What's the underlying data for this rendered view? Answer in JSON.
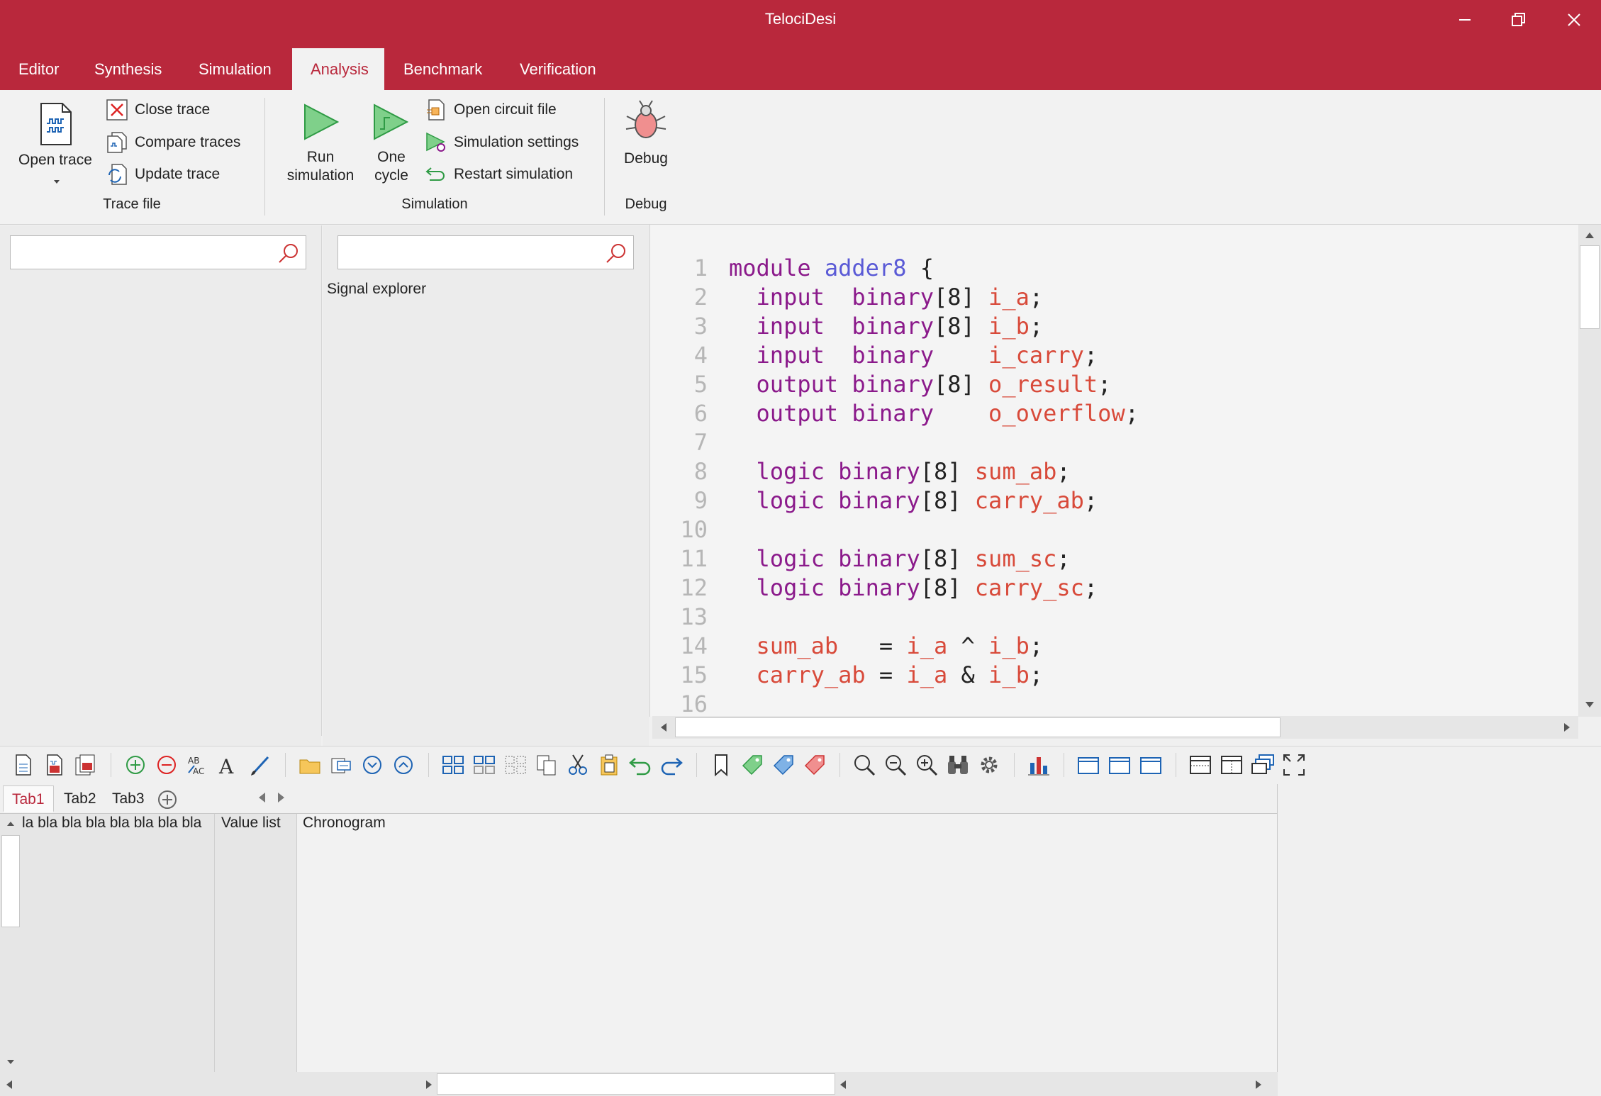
{
  "app": {
    "title": "TelociDesi"
  },
  "window_controls": {
    "minimize": "—",
    "restore": "❐",
    "close": "✕"
  },
  "tabs": [
    "Editor",
    "Synthesis",
    "Simulation",
    "Analysis",
    "Benchmark",
    "Verification"
  ],
  "active_tab": "Analysis",
  "ribbon": {
    "trace_file": {
      "open_trace": "Open trace",
      "close_trace": "Close trace",
      "compare_traces": "Compare traces",
      "update_trace": "Update trace",
      "group_label": "Trace file"
    },
    "simulation": {
      "run_simulation_line1": "Run",
      "run_simulation_line2": "simulation",
      "one_cycle_line1": "One",
      "one_cycle_line2": "cycle",
      "open_circuit_file": "Open circuit file",
      "simulation_settings": "Simulation settings",
      "restart_simulation": "Restart simulation",
      "group_label": "Simulation"
    },
    "debug": {
      "debug": "Debug",
      "group_label": "Debug"
    }
  },
  "left_pane": {
    "search_placeholder": ""
  },
  "signal_pane": {
    "search_placeholder": "",
    "title": "Signal explorer"
  },
  "editor": {
    "lines": [
      {
        "n": "1",
        "tokens": [
          [
            "kw",
            "module "
          ],
          [
            "mod",
            "adder8"
          ],
          [
            "pn",
            " {"
          ]
        ]
      },
      {
        "n": "2",
        "tokens": [
          [
            "kw",
            "  input  binary"
          ],
          [
            "pn",
            "[8] "
          ],
          [
            "id",
            "i_a"
          ],
          [
            "pn",
            ";"
          ]
        ]
      },
      {
        "n": "3",
        "tokens": [
          [
            "kw",
            "  input  binary"
          ],
          [
            "pn",
            "[8] "
          ],
          [
            "id",
            "i_b"
          ],
          [
            "pn",
            ";"
          ]
        ]
      },
      {
        "n": "4",
        "tokens": [
          [
            "kw",
            "  input  binary    "
          ],
          [
            "id",
            "i_carry"
          ],
          [
            "pn",
            ";"
          ]
        ]
      },
      {
        "n": "5",
        "tokens": [
          [
            "kw",
            "  output binary"
          ],
          [
            "pn",
            "[8] "
          ],
          [
            "id",
            "o_result"
          ],
          [
            "pn",
            ";"
          ]
        ]
      },
      {
        "n": "6",
        "tokens": [
          [
            "kw",
            "  output binary    "
          ],
          [
            "id",
            "o_overflow"
          ],
          [
            "pn",
            ";"
          ]
        ]
      },
      {
        "n": "7",
        "tokens": []
      },
      {
        "n": "8",
        "tokens": [
          [
            "kw",
            "  logic binary"
          ],
          [
            "pn",
            "[8] "
          ],
          [
            "id",
            "sum_ab"
          ],
          [
            "pn",
            ";"
          ]
        ]
      },
      {
        "n": "9",
        "tokens": [
          [
            "kw",
            "  logic binary"
          ],
          [
            "pn",
            "[8] "
          ],
          [
            "id",
            "carry_ab"
          ],
          [
            "pn",
            ";"
          ]
        ]
      },
      {
        "n": "10",
        "tokens": []
      },
      {
        "n": "11",
        "tokens": [
          [
            "kw",
            "  logic binary"
          ],
          [
            "pn",
            "[8] "
          ],
          [
            "id",
            "sum_sc"
          ],
          [
            "pn",
            ";"
          ]
        ]
      },
      {
        "n": "12",
        "tokens": [
          [
            "kw",
            "  logic binary"
          ],
          [
            "pn",
            "[8] "
          ],
          [
            "id",
            "carry_sc"
          ],
          [
            "pn",
            ";"
          ]
        ]
      },
      {
        "n": "13",
        "tokens": []
      },
      {
        "n": "14",
        "tokens": [
          [
            "id",
            "  sum_ab"
          ],
          [
            "pn",
            "   = "
          ],
          [
            "id",
            "i_a"
          ],
          [
            "pn",
            " ^ "
          ],
          [
            "id",
            "i_b"
          ],
          [
            "pn",
            ";"
          ]
        ]
      },
      {
        "n": "15",
        "tokens": [
          [
            "id",
            "  carry_ab"
          ],
          [
            "pn",
            " = "
          ],
          [
            "id",
            "i_a"
          ],
          [
            "pn",
            " & "
          ],
          [
            "id",
            "i_b"
          ],
          [
            "pn",
            ";"
          ]
        ]
      },
      {
        "n": "16",
        "tokens": []
      }
    ]
  },
  "bottom_tabs": [
    "Tab1",
    "Tab2",
    "Tab3"
  ],
  "bottom_active_tab": "Tab1",
  "columns": {
    "names": "la bla bla bla bla bla bla bla",
    "values": "Value list",
    "chronogram": "Chronogram"
  },
  "colors": {
    "accent": "#b9283c",
    "keyword": "#8b1a8b",
    "module": "#5a5ad6",
    "identifier": "#d84a3a"
  }
}
